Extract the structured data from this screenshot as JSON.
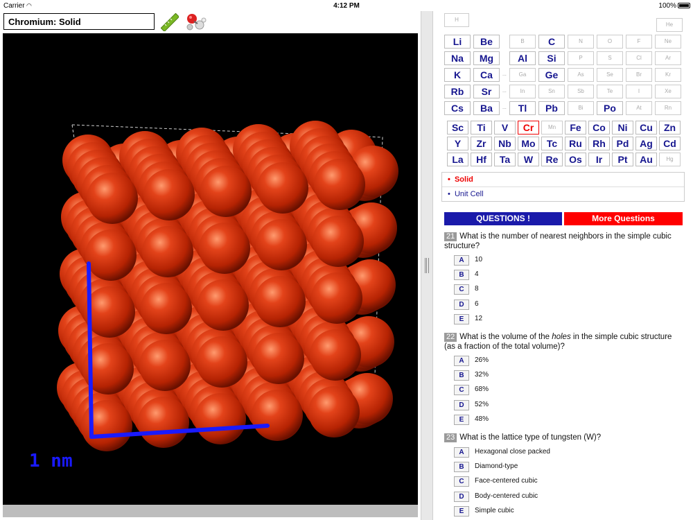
{
  "status": {
    "carrier": "Carrier",
    "time": "4:12 PM",
    "battery": "100%"
  },
  "header": {
    "title": "Chromium: Solid"
  },
  "viewer": {
    "scale_label": "1 nm",
    "atom_color": "#c62a06",
    "scale_color": "#1a1aff"
  },
  "periodic_table": {
    "row1": [
      "H",
      "He"
    ],
    "main_left": [
      [
        "Li",
        "Be"
      ],
      [
        "Na",
        "Mg"
      ],
      [
        "K",
        "Ca"
      ],
      [
        "Rb",
        "Sr"
      ],
      [
        "Cs",
        "Ba"
      ]
    ],
    "main_right": [
      [
        "B",
        "C",
        "N",
        "O",
        "F",
        "Ne"
      ],
      [
        "Al",
        "Si",
        "P",
        "S",
        "Cl",
        "Ar"
      ],
      [
        "Ga",
        "Ge",
        "As",
        "Se",
        "Br",
        "Kr"
      ],
      [
        "In",
        "Sn",
        "Sb",
        "Te",
        "I",
        "Xe"
      ],
      [
        "Tl",
        "Pb",
        "Bi",
        "Po",
        "At",
        "Rn"
      ]
    ],
    "transition": [
      [
        "Sc",
        "Ti",
        "V",
        "Cr",
        "Mn",
        "Fe",
        "Co",
        "Ni",
        "Cu",
        "Zn"
      ],
      [
        "Y",
        "Zr",
        "Nb",
        "Mo",
        "Tc",
        "Ru",
        "Rh",
        "Pd",
        "Ag",
        "Cd"
      ],
      [
        "La",
        "Hf",
        "Ta",
        "W",
        "Re",
        "Os",
        "Ir",
        "Pt",
        "Au",
        "Hg"
      ]
    ],
    "selected": "Cr"
  },
  "views": {
    "solid": "Solid",
    "unit_cell": "Unit Cell"
  },
  "buttons": {
    "questions": "QUESTIONS !",
    "more": "More Questions"
  },
  "questions": [
    {
      "num": "21",
      "text": "What is the number of nearest neighbors in the simple cubic structure?",
      "answers": [
        [
          "A",
          "10"
        ],
        [
          "B",
          "4"
        ],
        [
          "C",
          "8"
        ],
        [
          "D",
          "6"
        ],
        [
          "E",
          "12"
        ]
      ]
    },
    {
      "num": "22",
      "text_pre": "What is the volume of the ",
      "text_em": "holes",
      "text_post": " in the simple cubic structure (as a fraction of the total volume)?",
      "answers": [
        [
          "A",
          "26%"
        ],
        [
          "B",
          "32%"
        ],
        [
          "C",
          "68%"
        ],
        [
          "D",
          "52%"
        ],
        [
          "E",
          "48%"
        ]
      ]
    },
    {
      "num": "23",
      "text": "What is the lattice type of tungsten (W)?",
      "answers": [
        [
          "A",
          "Hexagonal close packed"
        ],
        [
          "B",
          "Diamond-type"
        ],
        [
          "C",
          "Face-centered cubic"
        ],
        [
          "D",
          "Body-centered cubic"
        ],
        [
          "E",
          "Simple cubic"
        ]
      ]
    }
  ]
}
